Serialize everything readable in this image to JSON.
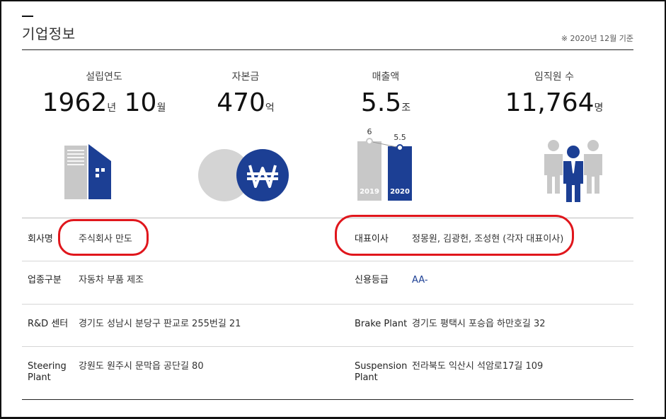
{
  "header": {
    "title": "기업정보",
    "basis": "※ 2020년 12월 기준"
  },
  "stats": [
    {
      "label": "설립연도",
      "value_parts": [
        {
          "num": "1962",
          "unit": "년"
        },
        {
          "num": " 10",
          "unit": "월"
        }
      ],
      "icon": "building-icon"
    },
    {
      "label": "자본금",
      "value_parts": [
        {
          "num": "470",
          "unit": "억"
        }
      ],
      "icon": "won-coin-icon"
    },
    {
      "label": "매출액",
      "value_parts": [
        {
          "num": "5.5",
          "unit": "조"
        }
      ],
      "icon": "revenue-bar-icon"
    },
    {
      "label": "임직원 수",
      "value_parts": [
        {
          "num": "11,764",
          "unit": "명"
        }
      ],
      "icon": "people-icon"
    }
  ],
  "revenue_chart": {
    "years": [
      "2019",
      "2020"
    ],
    "values": [
      6,
      5.5
    ],
    "value_labels": [
      "6",
      "5.5"
    ],
    "colors": [
      "#c8c8c8",
      "#1c3f94"
    ]
  },
  "info": {
    "company_name_label": "회사명",
    "company_name": "주식회사 만도",
    "ceo_label": "대표이사",
    "ceo": "정몽원, 김광헌, 조성현 (각자 대표이사)",
    "industry_label": "업종구분",
    "industry": "자동차 부품 제조",
    "credit_label": "신용등급",
    "credit": "AA-",
    "rnd_label": "R&D 센터",
    "rnd": "경기도 성남시 분당구 판교로 255번길 21",
    "brake_label": "Brake Plant",
    "brake": "경기도 평택시 포승읍 하만호길 32",
    "steering_label_1": "Steering",
    "steering_label_2": "Plant",
    "steering": "강원도 원주시 문막읍 공단길 80",
    "suspension_label_1": "Suspension",
    "suspension_label_2": "Plant",
    "suspension": "전라북도 익산시 석암로17길 109"
  },
  "colors": {
    "brand_blue": "#1c3f94",
    "gray": "#c8c8c8",
    "annotation_red": "#e0161c"
  }
}
